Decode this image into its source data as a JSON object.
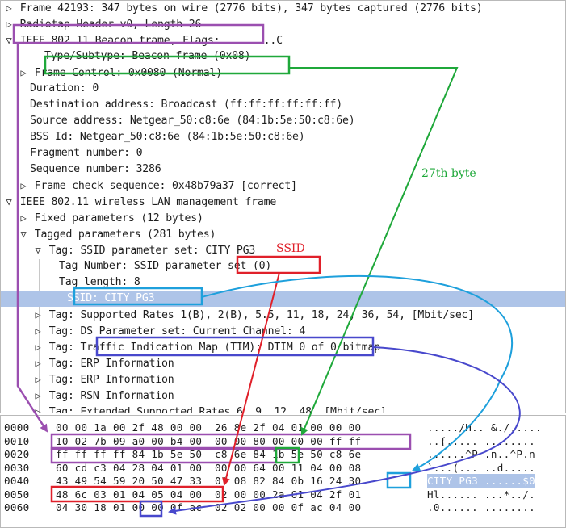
{
  "tree_rows": [
    {
      "label": "Frame 42193: 347 bytes on wire (2776 bits), 347 bytes captured (2776 bits)",
      "toggle": "▷"
    },
    {
      "label": "Radiotap Header v0, Length 26",
      "toggle": "▷"
    },
    {
      "label": "IEEE 802.11 Beacon frame, Flags: ........C",
      "toggle": "▽"
    },
    {
      "label": "Type/Subtype: Beacon frame (0x08)",
      "toggle": ""
    },
    {
      "label": "Frame Control: 0x0080 (Normal)",
      "toggle": "▷"
    },
    {
      "label": "Duration: 0",
      "toggle": ""
    },
    {
      "label": "Destination address: Broadcast (ff:ff:ff:ff:ff:ff)",
      "toggle": ""
    },
    {
      "label": "Source address: Netgear_50:c8:6e (84:1b:5e:50:c8:6e)",
      "toggle": ""
    },
    {
      "label": "BSS Id: Netgear_50:c8:6e (84:1b:5e:50:c8:6e)",
      "toggle": ""
    },
    {
      "label": "Fragment number: 0",
      "toggle": ""
    },
    {
      "label": "Sequence number: 3286",
      "toggle": ""
    },
    {
      "label": "Frame check sequence: 0x48b79a37 [correct]",
      "toggle": "▷"
    },
    {
      "label": "IEEE 802.11 wireless LAN management frame",
      "toggle": "▽"
    },
    {
      "label": "Fixed parameters (12 bytes)",
      "toggle": "▷"
    },
    {
      "label": "Tagged parameters (281 bytes)",
      "toggle": "▽"
    },
    {
      "label": "Tag: SSID parameter set: CITY PG3",
      "toggle": "▽"
    },
    {
      "label": "Tag Number: SSID parameter set (0)",
      "toggle": ""
    },
    {
      "label": "Tag length: 8",
      "toggle": ""
    },
    {
      "label": "SSID: CITY PG3",
      "toggle": ""
    },
    {
      "label": "Tag: Supported Rates 1(B), 2(B), 5.5, 11, 18, 24, 36, 54, [Mbit/sec]",
      "toggle": "▷"
    },
    {
      "label": "Tag: DS Parameter set: Current Channel: 4",
      "toggle": "▷"
    },
    {
      "label": "Tag: Traffic Indication Map (TIM): DTIM 0 of 0 bitmap",
      "toggle": "▷"
    },
    {
      "label": "Tag: ERP Information",
      "toggle": "▷"
    },
    {
      "label": "Tag: ERP Information",
      "toggle": "▷"
    },
    {
      "label": "Tag: RSN Information",
      "toggle": "▷"
    },
    {
      "label": "Tag: Extended Supported Rates 6, 9, 12, 48, [Mbit/sec]",
      "toggle": "▷"
    }
  ],
  "hex_rows": [
    {
      "offset": "0000",
      "bytes": "00 00 1a 00 2f 48 00 00  26 8e 2f 04 01 00 00 00",
      "ascii": "...../H.. &./....."
    },
    {
      "offset": "0010",
      "bytes": "10 02 7b 09 a0 00 b4 00  00 00 80 00 00 00 ff ff",
      "ascii": "..{..... ........"
    },
    {
      "offset": "0020",
      "bytes": "ff ff ff ff 84 1b 5e 50  c8 6e 84 1b 5e 50 c8 6e",
      "ascii": "......^P .n..^P.n"
    },
    {
      "offset": "0030",
      "bytes": "60 cd c3 04 28 04 01 00  00 00 64 00 11 04 00 08",
      "ascii": "`...(... ..d....."
    },
    {
      "offset": "0040",
      "bytes": "43 49 54 59 20 50 47 33  01 08 82 84 0b 16 24 30",
      "ascii": "CITY PG3 ......$0"
    },
    {
      "offset": "0050",
      "bytes": "48 6c 03 01 04 05 04 00  02 00 00 2a 01 04 2f 01",
      "ascii": "Hl...... ...*../."
    },
    {
      "offset": "0060",
      "bytes": "04 30 18 01 00 00 0f ac  02 02 00 00 0f ac 04 00",
      "ascii": ".0...... ........"
    }
  ],
  "annotations": {
    "ssid_label": "SSID",
    "byte27_label": "27th byte"
  },
  "colors": {
    "purple": "#9b4fb0",
    "green": "#1fa83a",
    "red": "#e0202a",
    "cyan": "#1ea0dc",
    "blue": "#4848cc",
    "selection": "#aec4e8"
  }
}
